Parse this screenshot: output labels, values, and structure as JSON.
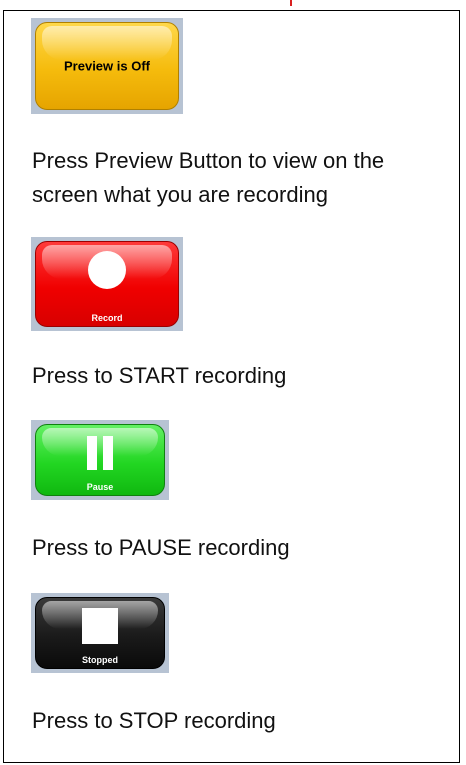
{
  "preview": {
    "button_label": "Preview is Off",
    "description": "Press Preview Button to view on the screen what you are recording"
  },
  "record": {
    "button_label": "Record",
    "description": "Press to START recording"
  },
  "pause": {
    "button_label": "Pause",
    "description": "Press to PAUSE recording"
  },
  "stop": {
    "button_label": "Stopped",
    "description": "Press to STOP recording"
  },
  "colors": {
    "preview": "#f5bb0c",
    "record": "#f00000",
    "pause": "#22d622",
    "stop": "#1a1a1a",
    "button_surround": "#b7c3d3"
  },
  "icons": {
    "record": "circle-icon",
    "pause": "pause-icon",
    "stop": "stop-square-icon"
  }
}
